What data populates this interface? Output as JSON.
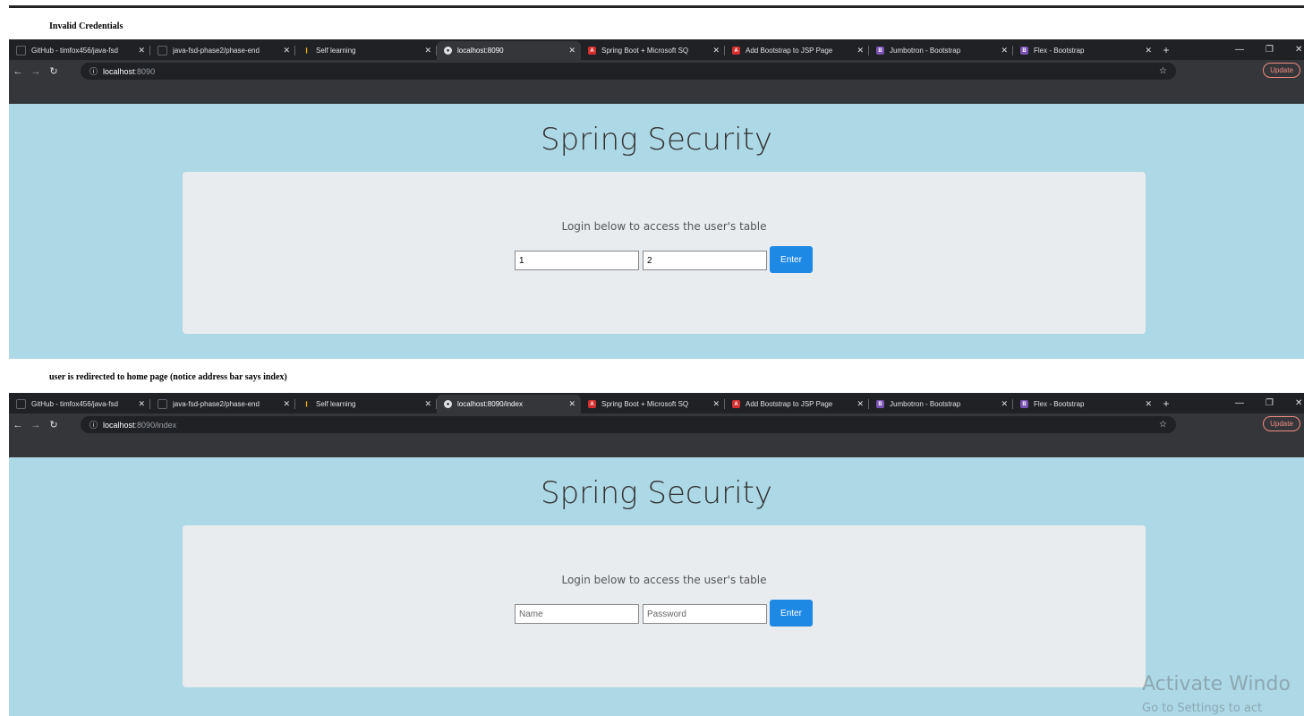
{
  "captions": {
    "first": "Invalid Credentials",
    "second": "user is redirected to home page (notice address bar says index)"
  },
  "screens": [
    {
      "tabs": [
        {
          "title": "GitHub - timfox456/java-fsd",
          "icon": "github-icon",
          "active": false
        },
        {
          "title": "java-fsd-phase2/phase-end",
          "icon": "github-icon",
          "active": false
        },
        {
          "title": "Self learning",
          "icon": "bars-icon",
          "active": false
        },
        {
          "title": "localhost:8090",
          "icon": "globe-icon",
          "active": true
        },
        {
          "title": "Spring Boot + Microsoft SQ",
          "icon": "red-a-icon",
          "active": false
        },
        {
          "title": "Add Bootstrap to JSP Page",
          "icon": "red-a-icon",
          "active": false
        },
        {
          "title": "Jumbotron - Bootstrap",
          "icon": "bootstrap-icon",
          "active": false
        },
        {
          "title": "Flex - Bootstrap",
          "icon": "bootstrap-icon",
          "active": false
        }
      ],
      "url_host": "localhost",
      "url_rest": ":8090",
      "update_label": "Update",
      "heading": "Spring Security",
      "lead": "Login below to access the user's table",
      "name_value": "1",
      "password_value": "2",
      "name_placeholder": "Name",
      "password_placeholder": "Password",
      "button_label": "Enter"
    },
    {
      "tabs": [
        {
          "title": "GitHub - timfox456/java-fsd",
          "icon": "github-icon",
          "active": false
        },
        {
          "title": "java-fsd-phase2/phase-end",
          "icon": "github-icon",
          "active": false
        },
        {
          "title": "Self learning",
          "icon": "bars-icon",
          "active": false
        },
        {
          "title": "localhost:8090/index",
          "icon": "globe-icon",
          "active": true
        },
        {
          "title": "Spring Boot + Microsoft SQ",
          "icon": "red-a-icon",
          "active": false
        },
        {
          "title": "Add Bootstrap to JSP Page",
          "icon": "red-a-icon",
          "active": false
        },
        {
          "title": "Jumbotron - Bootstrap",
          "icon": "bootstrap-icon",
          "active": false
        },
        {
          "title": "Flex - Bootstrap",
          "icon": "bootstrap-icon",
          "active": false
        }
      ],
      "url_host": "localhost",
      "url_rest": ":8090/index",
      "update_label": "Update",
      "heading": "Spring Security",
      "lead": "Login below to access the user's table",
      "name_value": "",
      "password_value": "",
      "name_placeholder": "Name",
      "password_placeholder": "Password",
      "button_label": "Enter"
    }
  ],
  "watermark": {
    "line1": "Activate Windo",
    "line2": "Go to Settings to act"
  },
  "colors": {
    "page_bg": "#add8e6",
    "jumbotron_bg": "#e9ecef",
    "button_bg": "#1e88e5",
    "chrome_dark": "#202124",
    "chrome_toolbar": "#35363a"
  }
}
